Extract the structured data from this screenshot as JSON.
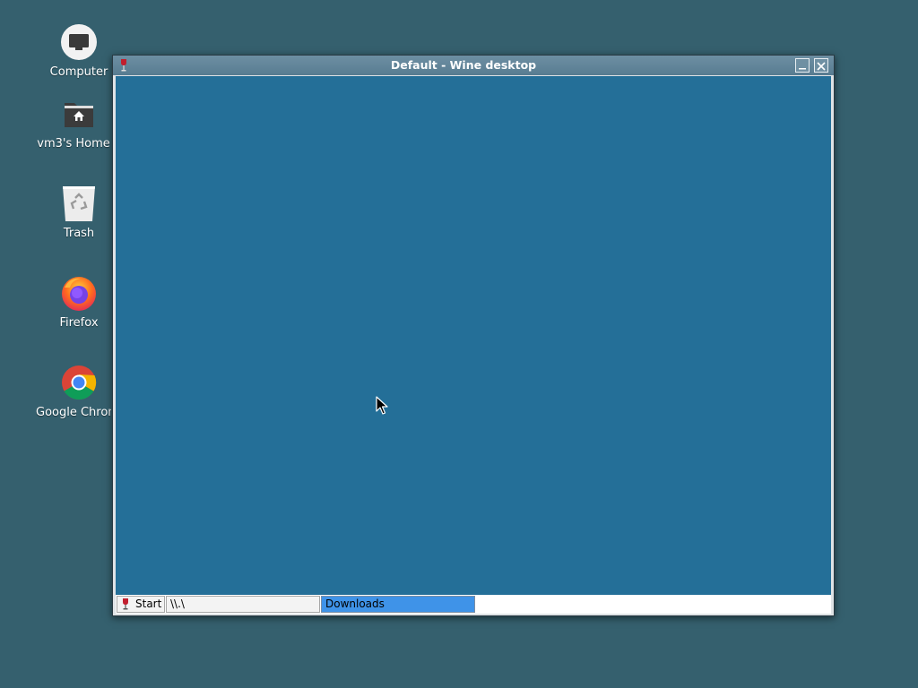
{
  "desktop": {
    "background_color": "#35606e",
    "icons": [
      {
        "label": "Computer",
        "icon": "computer-icon"
      },
      {
        "label": "vm3's Home",
        "icon": "home-folder-icon"
      },
      {
        "label": "Trash",
        "icon": "trash-icon"
      },
      {
        "label": "Firefox",
        "icon": "firefox-icon"
      },
      {
        "label": "Google Chrome",
        "icon": "chrome-icon"
      }
    ]
  },
  "window": {
    "title": "Default - Wine desktop",
    "icon": "wine-glass-icon",
    "client_color": "#246f98",
    "controls": {
      "minimize_icon": "minimize-icon",
      "close_icon": "close-icon"
    }
  },
  "taskbar": {
    "start_label": "Start",
    "tasks": [
      {
        "label": "\\\\.\\",
        "active": false
      },
      {
        "label": "Downloads",
        "active": true
      }
    ],
    "active_color": "#3f93e8"
  }
}
